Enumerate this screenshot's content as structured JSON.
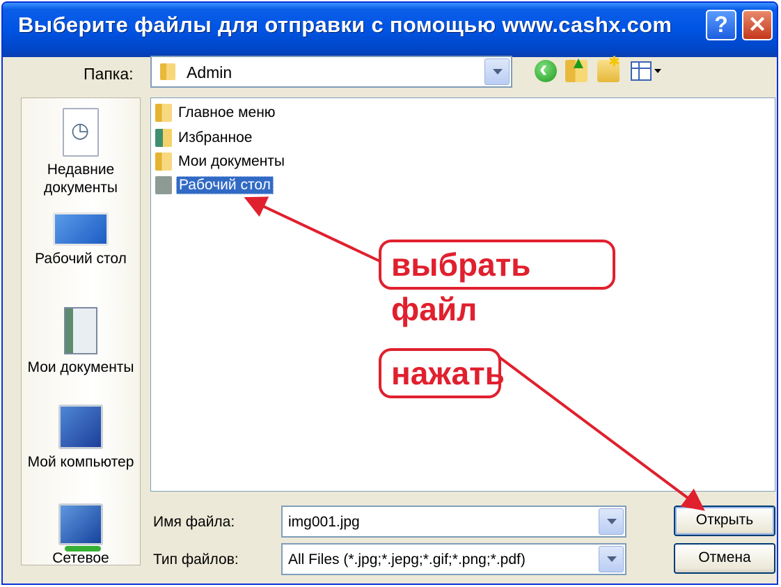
{
  "window": {
    "title": "Выберите файлы для отправки с помощью www.cashx.com",
    "help_label": "?",
    "close_label": "✕"
  },
  "toolbar": {
    "lookin_label": "Папка:",
    "lookin_value": "Admin",
    "icons": [
      "back-icon",
      "up-folder-icon",
      "new-folder-icon",
      "views-icon"
    ]
  },
  "places": [
    {
      "label": "Недавние документы",
      "icon": "recent-documents-icon"
    },
    {
      "label": "Рабочий стол",
      "icon": "desktop-icon"
    },
    {
      "label": "Мои документы",
      "icon": "my-documents-icon"
    },
    {
      "label": "Мой компьютер",
      "icon": "my-computer-icon"
    },
    {
      "label": "Сетевое",
      "icon": "network-icon"
    }
  ],
  "files": [
    {
      "name": "Главное меню",
      "icon": "folder-icon",
      "selected": false
    },
    {
      "name": "Избранное",
      "icon": "favorites-folder-icon",
      "selected": false
    },
    {
      "name": "Мои документы",
      "icon": "folder-icon",
      "selected": false
    },
    {
      "name": "Рабочий стол",
      "icon": "desktop-folder-icon",
      "selected": true
    }
  ],
  "form": {
    "filename_label": "Имя файла:",
    "filename_value": "img001.jpg",
    "filetype_label": "Тип файлов:",
    "filetype_value": "All Files (*.jpg;*.jepg;*.gif;*.png;*.pdf)"
  },
  "buttons": {
    "open": "Открыть",
    "cancel": "Отмена"
  },
  "annotations": {
    "select_file": "выбрать файл",
    "press": "нажать",
    "color": "#e0202e"
  },
  "colors": {
    "titlebar": "#0054e3",
    "selection": "#316ac5",
    "dialog_bg": "#ece9d8"
  }
}
